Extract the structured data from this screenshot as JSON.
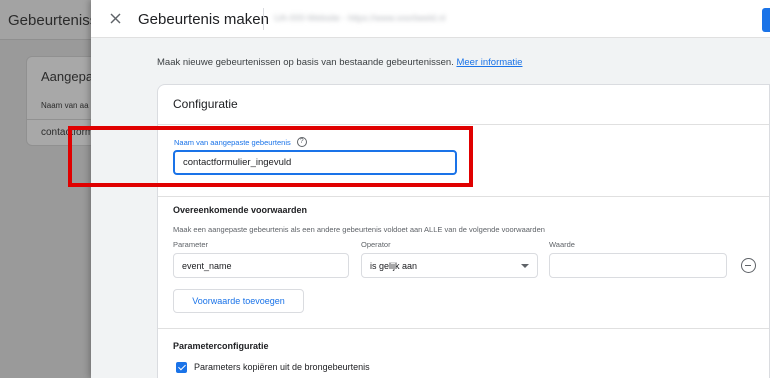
{
  "background": {
    "title": "Gebeurtenisse",
    "card_title": "Aangepaste",
    "column_header": "Naam van aa",
    "row_value": "contactform"
  },
  "dialog": {
    "title": "Gebeurtenis maken",
    "blurred_property": "UA-000-Website - https://www.voorbeeld.nl",
    "intro_text": "Maak nieuwe gebeurtenissen op basis van bestaande gebeurtenissen.",
    "intro_link": "Meer informatie",
    "accent_color": "#1a73e8",
    "highlight_color": "#e00000"
  },
  "config": {
    "title": "Configuratie",
    "name_label": "Naam van aangepaste gebeurtenis",
    "name_value": "contactformulier_ingevuld",
    "conditions": {
      "title": "Overeenkomende voorwaarden",
      "description": "Maak een aangepaste gebeurtenis als een andere gebeurtenis voldoet aan ALLE van de volgende voorwaarden",
      "columns": {
        "parameter": "Parameter",
        "operator": "Operator",
        "value": "Waarde"
      },
      "row": {
        "parameter": "event_name",
        "operator": "is gelijk aan",
        "value": ""
      },
      "add_button": "Voorwaarde toevoegen"
    },
    "parameters": {
      "title": "Parameterconfiguratie",
      "copy_label": "Parameters kopiëren uit de brongebeurtenis",
      "copy_checked": true
    }
  }
}
